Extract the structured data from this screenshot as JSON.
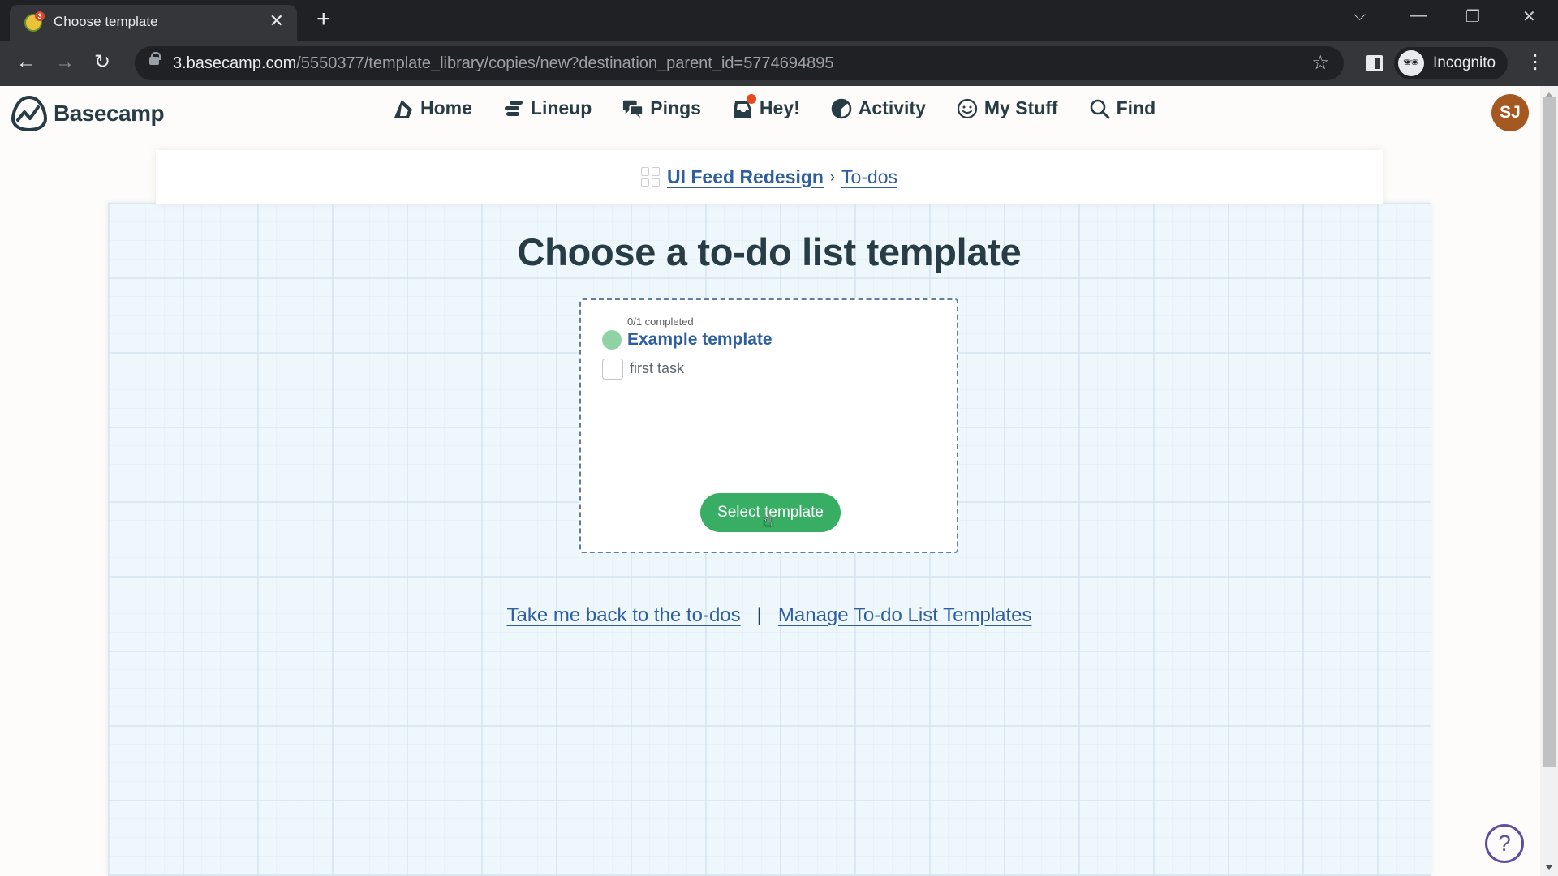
{
  "browser": {
    "tab_title": "Choose template",
    "favicon_badge": "3",
    "url_host": "3.basecamp.com",
    "url_path": "/5550377/template_library/copies/new?destination_parent_id=5774694895",
    "profile_label": "Incognito"
  },
  "app": {
    "logo_name": "Basecamp",
    "nav": [
      {
        "label": "Home",
        "icon": "home-icon"
      },
      {
        "label": "Lineup",
        "icon": "lineup-icon"
      },
      {
        "label": "Pings",
        "icon": "pings-icon"
      },
      {
        "label": "Hey!",
        "icon": "hey-icon",
        "has_notification": true
      },
      {
        "label": "Activity",
        "icon": "activity-icon"
      },
      {
        "label": "My Stuff",
        "icon": "my-stuff-icon"
      },
      {
        "label": "Find",
        "icon": "search-icon"
      }
    ],
    "avatar_initials": "SJ",
    "avatar_color": "#a5581f"
  },
  "breadcrumb": {
    "project": "UI Feed Redesign",
    "separator": "›",
    "current": "To-dos"
  },
  "page": {
    "title": "Choose a to-do list template"
  },
  "template": {
    "progress_text": "0/1 completed",
    "completed": 0,
    "total": 1,
    "name": "Example template",
    "tasks": [
      {
        "label": "first task",
        "checked": false
      }
    ],
    "select_label": "Select template",
    "accent_color": "#37ae63"
  },
  "footer": {
    "back_link": "Take me back to the to-dos",
    "separator": "|",
    "manage_link": "Manage To-do List Templates"
  },
  "help": {
    "label": "?"
  }
}
